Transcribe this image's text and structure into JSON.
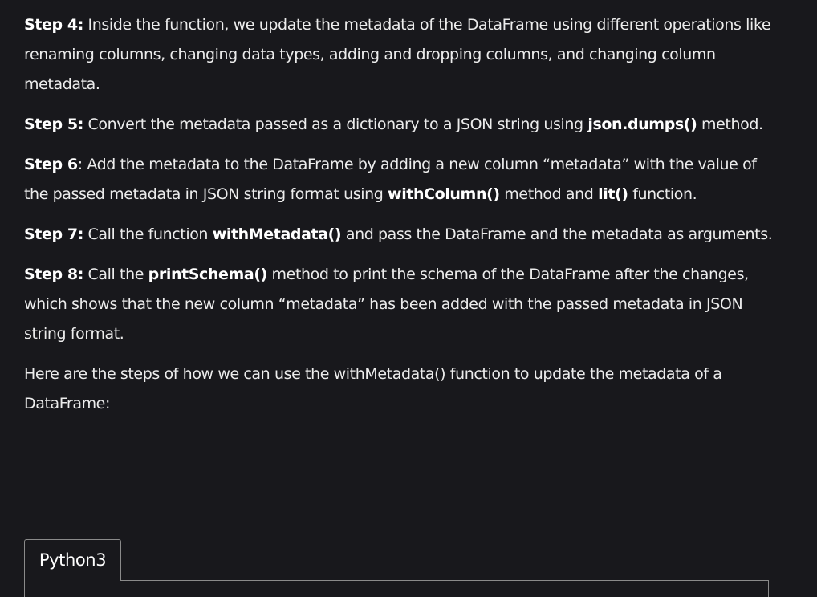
{
  "steps": [
    {
      "label": "Step 4:",
      "parts": [
        {
          "t": " Inside the function, we update the metadata of the DataFrame using different operations like renaming columns, changing data types, adding and dropping columns, and changing column metadata."
        }
      ]
    },
    {
      "label": "Step 5:",
      "parts": [
        {
          "t": " Convert the metadata passed as a dictionary to a JSON string using "
        },
        {
          "t": "json.dumps()",
          "b": true
        },
        {
          "t": " method."
        }
      ]
    },
    {
      "label": "Step 6",
      "parts": [
        {
          "t": ": Add the metadata to the DataFrame by adding a new column “metadata” with the value of the passed metadata in JSON string format using "
        },
        {
          "t": "withColumn()",
          "b": true
        },
        {
          "t": " method and "
        },
        {
          "t": "lit()",
          "b": true
        },
        {
          "t": " function."
        }
      ]
    },
    {
      "label": "Step 7:",
      "parts": [
        {
          "t": " Call the function "
        },
        {
          "t": "withMetadata()",
          "b": true
        },
        {
          "t": " and pass the DataFrame and the metadata as arguments."
        }
      ]
    },
    {
      "label": "Step 8:",
      "parts": [
        {
          "t": " Call the "
        },
        {
          "t": "printSchema()",
          "b": true
        },
        {
          "t": " method to print the schema of the DataFrame after the changes, which shows that the new column “metadata” has been added with the passed metadata in JSON string format."
        }
      ]
    }
  ],
  "intro_text": "Here are the steps of how we can use the withMetadata() function to update the metadata of a DataFrame:",
  "code_tab": {
    "label": "Python3"
  }
}
